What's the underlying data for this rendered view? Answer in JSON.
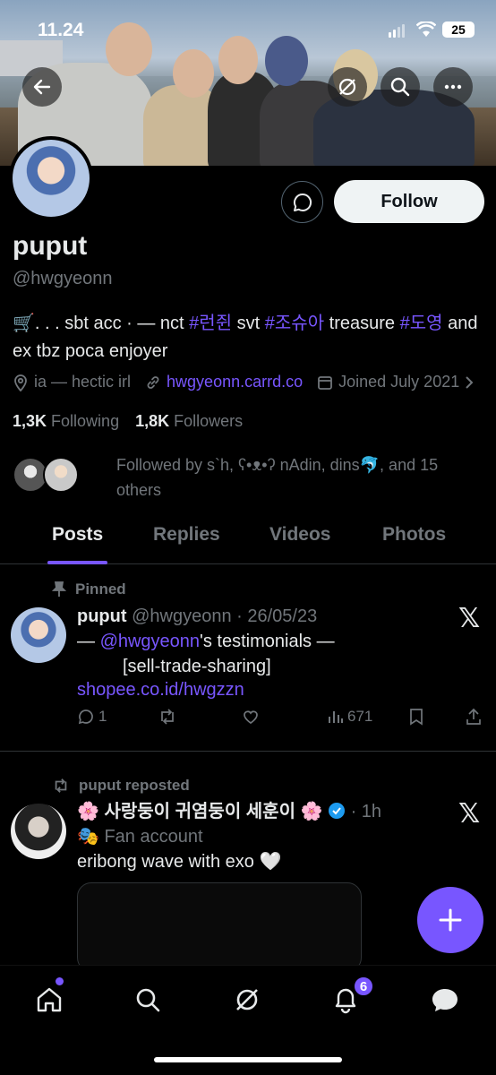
{
  "status": {
    "time": "11.24",
    "battery": "25"
  },
  "profile": {
    "name": "puput",
    "handle": "@hwgyeonn",
    "follow_label": "Follow",
    "bio_parts": [
      "🛒. . . sbt acc · — nct ",
      "#런쥔",
      " svt ",
      "#조슈아",
      " treasure ",
      "#도영",
      " and ex tbz poca enjoyer"
    ],
    "location": "ia — hectic irl",
    "website": "hwgyeonn.carrd.co",
    "joined": "Joined July 2021",
    "following_count": "1,3K",
    "following_label": "Following",
    "followers_count": "1,8K",
    "followers_label": "Followers",
    "followed_by": "Followed by s`h, ʕ•ᴥ•ʔ nAdin, dins🐬, and 15 others"
  },
  "tabs": [
    "Posts",
    "Replies",
    "Videos",
    "Photos"
  ],
  "posts": [
    {
      "pinned_label": "Pinned",
      "author": "puput",
      "handle_date": "@hwgyeonn · 26/05/23",
      "line1_prefix": "— ",
      "line1_mention": "@hwgyeonn",
      "line1_suffix": "'s testimonials —",
      "line2": "[sell-trade-sharing]",
      "line3_link": "shopee.co.id/hwgzzn",
      "replies": "1",
      "views": "671"
    },
    {
      "repost_label": "puput reposted",
      "author": "🌸 사랑둥이 귀염둥이 세훈이 🌸",
      "time": "· 1h",
      "subtitle": "🎭 Fan account",
      "text": "eribong wave with exo 🤍"
    }
  ],
  "nav": {
    "notif_badge": "6"
  },
  "colors": {
    "accent": "#7856ff",
    "bg": "#000000",
    "muted": "#71767b"
  }
}
